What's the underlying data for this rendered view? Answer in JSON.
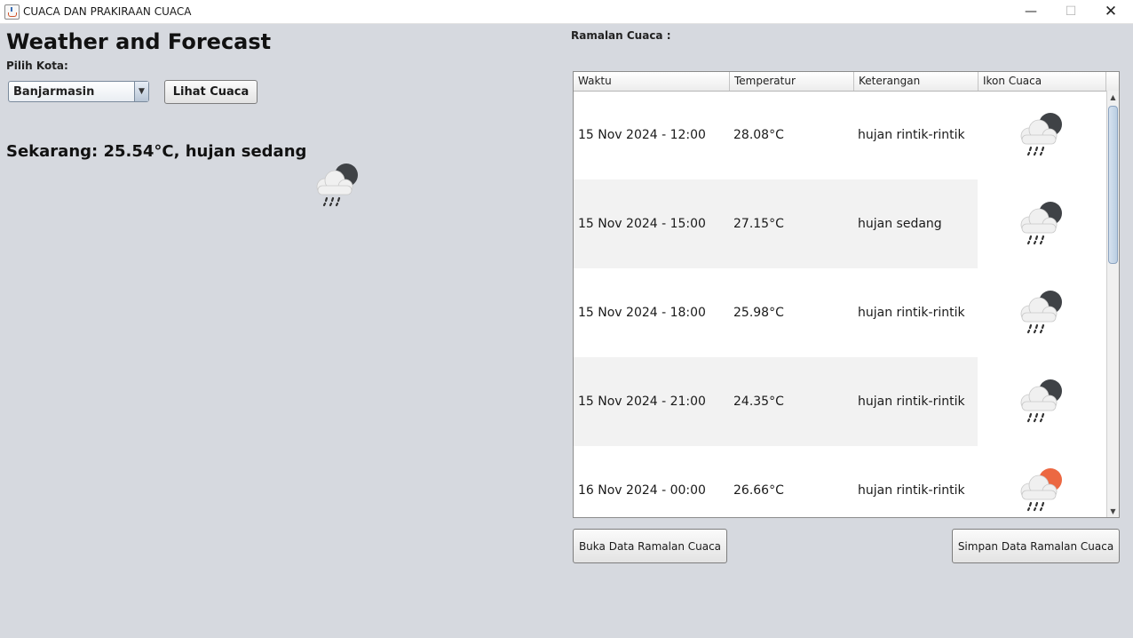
{
  "window": {
    "title": "CUACA DAN PRAKIRAAN CUACA",
    "minimize": "—",
    "maximize": "☐",
    "close": "✕"
  },
  "left": {
    "heading": "Weather and Forecast",
    "pilih_kota_label": "Pilih Kota:",
    "city_selected": "Banjarmasin",
    "lihat_cuaca_button": "Lihat Cuaca",
    "current_text": "Sekarang: 25.54°C, hujan sedang",
    "current_icon": "rain-moon-night-icon"
  },
  "right": {
    "forecast_label": "Ramalan Cuaca :",
    "columns": [
      "Waktu",
      "Temperatur",
      "Keterangan",
      "Ikon Cuaca"
    ],
    "rows": [
      {
        "waktu": "15 Nov 2024 - 12:00",
        "temperatur": "28.08°C",
        "keterangan": "hujan rintik-rintik",
        "icon": "rain-moon-night-icon"
      },
      {
        "waktu": "15 Nov 2024 - 15:00",
        "temperatur": "27.15°C",
        "keterangan": "hujan sedang",
        "icon": "rain-moon-night-icon"
      },
      {
        "waktu": "15 Nov 2024 - 18:00",
        "temperatur": "25.98°C",
        "keterangan": "hujan rintik-rintik",
        "icon": "rain-moon-night-icon"
      },
      {
        "waktu": "15 Nov 2024 - 21:00",
        "temperatur": "24.35°C",
        "keterangan": "hujan rintik-rintik",
        "icon": "rain-moon-night-icon"
      },
      {
        "waktu": "16 Nov 2024 - 00:00",
        "temperatur": "26.66°C",
        "keterangan": "hujan rintik-rintik",
        "icon": "rain-sun-day-icon"
      }
    ],
    "buka_button": "Buka Data Ramalan Cuaca",
    "simpan_button": "Simpan Data Ramalan Cuaca"
  },
  "colors": {
    "background": "#d6d9df",
    "night_orb": "#3f4246",
    "day_orb": "#ec6842",
    "cloud": "#f2f2f2",
    "rain": "#333333",
    "row_stripe": "#f2f2f2"
  }
}
